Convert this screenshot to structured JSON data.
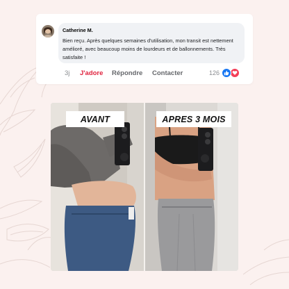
{
  "comment": {
    "author": "Catherine M.",
    "text": "Bien reçu. Après quelques semaines d'utilisation, mon transit est nettement amélioré, avec beaucoup moins de lourdeurs et de ballonnements. Très satisfaite !",
    "time": "3j",
    "like_label": "J'adore",
    "reply_label": "Répondre",
    "contact_label": "Contacter",
    "reaction_count": "126",
    "reactions": [
      "like-icon",
      "heart-icon"
    ]
  },
  "photo": {
    "before_label": "AVANT",
    "after_label": "APRES 3 MOIS"
  },
  "colors": {
    "background": "#fbf1ef",
    "like_active": "#e0233e",
    "like_reaction": "#1877f2",
    "love_reaction": "#f33e58"
  }
}
